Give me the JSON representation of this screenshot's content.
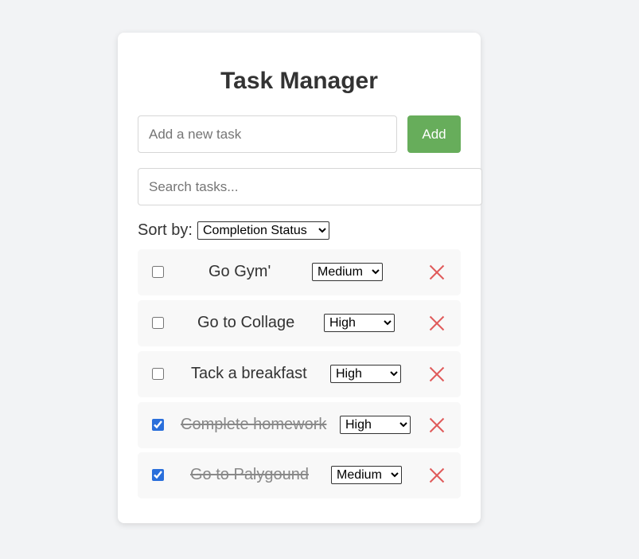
{
  "app": {
    "title": "Task Manager"
  },
  "new_task": {
    "placeholder": "Add a new task",
    "value": "",
    "add_label": "Add"
  },
  "search": {
    "placeholder": "Search tasks...",
    "value": ""
  },
  "sort": {
    "label": "Sort by:",
    "selected": "Completion Status"
  },
  "colors": {
    "add_button": "#67ad5b",
    "delete_icon": "#e05a5a",
    "checkbox_accent": "#2a6fdb",
    "background": "#f2f3f5"
  },
  "tasks": [
    {
      "text": "Go Gym'",
      "priority": "Medium",
      "completed": false,
      "delete_icon": "close-icon"
    },
    {
      "text": "Go to Collage",
      "priority": "High",
      "completed": false,
      "delete_icon": "close-icon"
    },
    {
      "text": "Tack a breakfast",
      "priority": "High",
      "completed": false,
      "delete_icon": "close-icon"
    },
    {
      "text": "Complete homework",
      "priority": "High",
      "completed": true,
      "delete_icon": "close-icon"
    },
    {
      "text": "Go to Palygound",
      "priority": "Medium",
      "completed": true,
      "delete_icon": "close-icon"
    }
  ]
}
